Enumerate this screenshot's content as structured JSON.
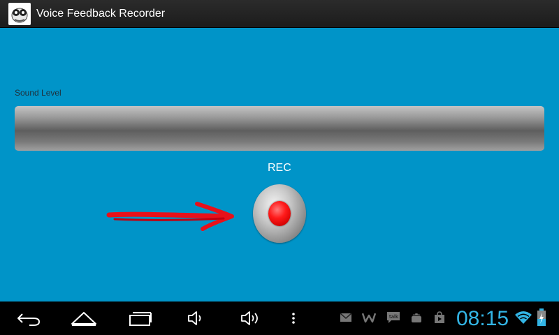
{
  "app": {
    "title": "Voice Feedback Recorder",
    "icon": "app-logo-icon"
  },
  "main": {
    "sound_level_label": "Sound Level",
    "sound_level_value": 0,
    "rec_label": "REC",
    "rec_button_icon": "record-icon",
    "annotation": "red-arrow-pointing-right",
    "background_color": "#0094c8"
  },
  "navbar": {
    "buttons": [
      "back-icon",
      "home-icon",
      "recent-apps-icon",
      "volume-down-icon",
      "volume-up-icon",
      "menu-icon"
    ],
    "notifications": [
      "gmail-icon",
      "w-app-icon",
      "talk-icon",
      "android-icon",
      "store-icon"
    ],
    "clock": "08:15",
    "status": [
      "wifi-icon",
      "battery-icon"
    ],
    "accent_color": "#33b5e5"
  }
}
